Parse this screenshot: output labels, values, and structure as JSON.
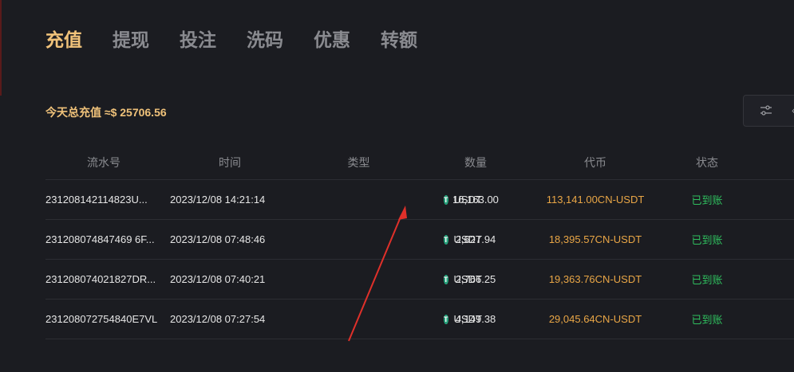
{
  "tabs": [
    {
      "label": "充值",
      "active": true
    },
    {
      "label": "提现",
      "active": false
    },
    {
      "label": "投注",
      "active": false
    },
    {
      "label": "洗码",
      "active": false
    },
    {
      "label": "优惠",
      "active": false
    },
    {
      "label": "转额",
      "active": false
    }
  ],
  "summary": {
    "text": "今天总充值 ≈$ 25706.56"
  },
  "filter": {
    "icon": "sliders-icon"
  },
  "table": {
    "headers": [
      "流水号",
      "时间",
      "类型",
      "数量",
      "代币",
      "状态"
    ],
    "rows": [
      {
        "id": "231208142114823U...",
        "time": "2023/12/08 14:21:14",
        "type": "USDT",
        "amount": "16,163.00",
        "coin": "113,141.00CN-USDT",
        "status": "已到账"
      },
      {
        "id": "231208074847469 6F...",
        "time": "2023/12/08 07:48:46",
        "type": "USDT",
        "amount": "2,627.94",
        "coin": "18,395.57CN-USDT",
        "status": "已到账"
      },
      {
        "id": "231208074021827DR...",
        "time": "2023/12/08 07:40:21",
        "type": "USDT",
        "amount": "2,766.25",
        "coin": "19,363.76CN-USDT",
        "status": "已到账"
      },
      {
        "id": "231208072754840E7VL",
        "time": "2023/12/08 07:27:54",
        "type": "USDT",
        "amount": "4,149.38",
        "coin": "29,045.64CN-USDT",
        "status": "已到账"
      }
    ]
  },
  "colors": {
    "accent": "#f0c27a",
    "coin": "#e9a646",
    "status": "#2fbf5e",
    "background": "#1b1c21",
    "annotation_arrow": "#e0302a"
  }
}
